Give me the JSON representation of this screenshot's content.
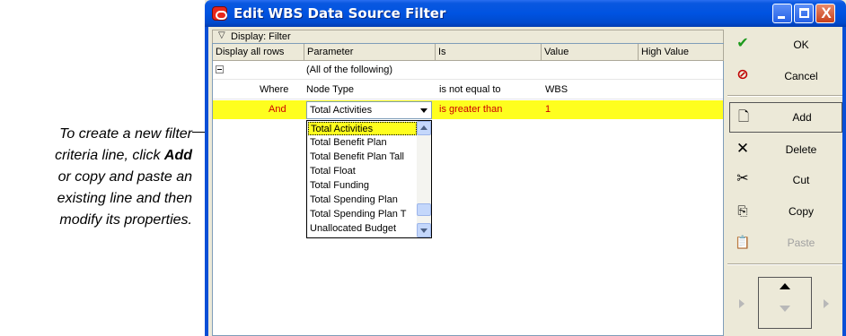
{
  "callout": {
    "line1": "To create a new filter",
    "line2_pre": "criteria line, click ",
    "line2_bold": "Add",
    "line3": "or copy and paste an",
    "line4": "existing line and then",
    "line5": "modify its properties."
  },
  "window": {
    "title": "Edit WBS Data Source Filter",
    "buttons": {
      "minimize": "minimize",
      "maximize": "maximize",
      "close": "X"
    }
  },
  "grid": {
    "group_label": "Display: Filter",
    "columns": [
      "Display all rows",
      "Parameter",
      "Is",
      "Value",
      "High Value"
    ],
    "rows": [
      {
        "param": "(All of the following)"
      },
      {
        "display": "Where",
        "param": "Node Type",
        "is": "is not equal to",
        "value": "WBS"
      },
      {
        "display": "And",
        "param": "Total Activities",
        "is": "is greater than",
        "value": "1"
      }
    ],
    "dropdown_items": [
      "Total Activities",
      "Total Benefit Plan",
      "Total Benefit Plan Tall",
      "Total Float",
      "Total Funding",
      "Total Spending Plan",
      "Total Spending Plan T",
      "Unallocated Budget"
    ]
  },
  "side_buttons": {
    "ok": "OK",
    "cancel": "Cancel",
    "add": "Add",
    "delete": "Delete",
    "cut": "Cut",
    "copy": "Copy",
    "paste": "Paste"
  },
  "colors": {
    "selection": "#fefe1e",
    "titlebar": "#0053e1",
    "accent_red": "#cc0000"
  }
}
